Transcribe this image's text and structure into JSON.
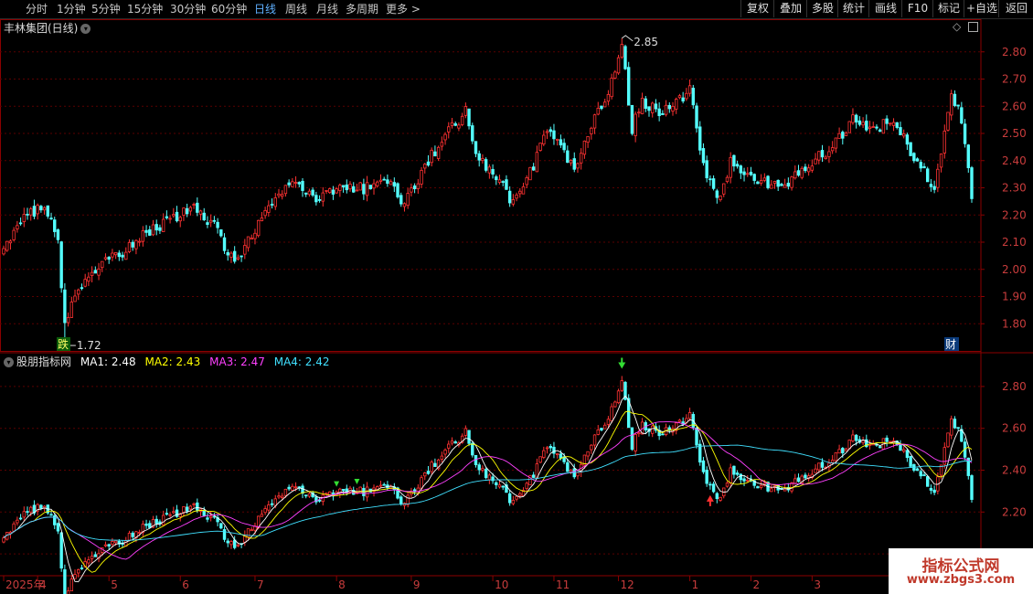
{
  "toolbar": {
    "periods": [
      {
        "label": "分时",
        "active": false
      },
      {
        "label": "1分钟",
        "active": false
      },
      {
        "label": "5分钟",
        "active": false
      },
      {
        "label": "15分钟",
        "active": false
      },
      {
        "label": "30分钟",
        "active": false
      },
      {
        "label": "60分钟",
        "active": false
      },
      {
        "label": "日线",
        "active": true
      },
      {
        "label": "周线",
        "active": false
      },
      {
        "label": "月线",
        "active": false
      },
      {
        "label": "多周期",
        "active": false
      },
      {
        "label": "更多 >",
        "active": false
      }
    ],
    "actions": [
      "复权",
      "叠加",
      "多股",
      "统计",
      "画线",
      "F10",
      "标记",
      "+自选",
      "返回"
    ]
  },
  "main_panel": {
    "title": "丰林集团(日线)",
    "high_marker": "2.85",
    "low_marker": "1.72",
    "badge_left": "跌",
    "badge_right": "财",
    "y_labels": [
      "2.80",
      "2.70",
      "2.60",
      "2.50",
      "2.40",
      "2.30",
      "2.20",
      "2.10",
      "2.00",
      "1.90",
      "1.80"
    ]
  },
  "indicator_panel": {
    "name": "股朋指标网",
    "ma": [
      {
        "label": "MA1:",
        "value": "2.48",
        "color": "#ffffff"
      },
      {
        "label": "MA2:",
        "value": "2.43",
        "color": "#ffff00"
      },
      {
        "label": "MA3:",
        "value": "2.47",
        "color": "#ff40ff"
      },
      {
        "label": "MA4:",
        "value": "2.42",
        "color": "#40e0ff"
      }
    ],
    "y_labels": [
      "2.80",
      "2.60",
      "2.40",
      "2.20",
      "2.00"
    ]
  },
  "date_axis": {
    "labels": [
      "2025年",
      "4",
      "5",
      "6",
      "7",
      "8",
      "9",
      "10",
      "11",
      "12",
      "1",
      "2",
      "3"
    ]
  },
  "watermark": {
    "line1": "指标公式网",
    "line2": "www.zbgs3.com"
  },
  "colors": {
    "up": "#ff3232",
    "down": "#54ffff",
    "grid": "#5a0000",
    "border": "#8b0000",
    "axis_text": "#c83c3c"
  },
  "chart_data": {
    "type": "candlestick",
    "title": "丰林集团(日线)",
    "price_range_main": [
      1.7,
      2.9
    ],
    "price_range_indicator": [
      1.9,
      2.9
    ],
    "month_start_index": [
      0,
      10,
      31,
      52,
      74,
      98,
      120,
      144,
      162,
      181,
      202,
      220,
      238
    ],
    "close_path": [
      [
        0,
        2.07
      ],
      [
        5,
        2.18
      ],
      [
        12,
        2.24
      ],
      [
        16,
        2.1
      ],
      [
        18,
        1.8
      ],
      [
        22,
        1.93
      ],
      [
        30,
        2.03
      ],
      [
        34,
        2.05
      ],
      [
        40,
        2.12
      ],
      [
        48,
        2.18
      ],
      [
        56,
        2.22
      ],
      [
        62,
        2.16
      ],
      [
        68,
        2.02
      ],
      [
        74,
        2.15
      ],
      [
        80,
        2.26
      ],
      [
        86,
        2.32
      ],
      [
        92,
        2.26
      ],
      [
        98,
        2.3
      ],
      [
        106,
        2.3
      ],
      [
        112,
        2.34
      ],
      [
        118,
        2.24
      ],
      [
        126,
        2.42
      ],
      [
        132,
        2.52
      ],
      [
        136,
        2.58
      ],
      [
        140,
        2.4
      ],
      [
        146,
        2.33
      ],
      [
        150,
        2.24
      ],
      [
        154,
        2.32
      ],
      [
        160,
        2.52
      ],
      [
        164,
        2.45
      ],
      [
        168,
        2.36
      ],
      [
        174,
        2.55
      ],
      [
        178,
        2.66
      ],
      [
        180,
        2.73
      ],
      [
        182,
        2.82
      ],
      [
        185,
        2.52
      ],
      [
        188,
        2.62
      ],
      [
        193,
        2.58
      ],
      [
        197,
        2.6
      ],
      [
        202,
        2.66
      ],
      [
        206,
        2.37
      ],
      [
        211,
        2.25
      ],
      [
        214,
        2.4
      ],
      [
        220,
        2.35
      ],
      [
        226,
        2.31
      ],
      [
        232,
        2.33
      ],
      [
        238,
        2.4
      ],
      [
        244,
        2.45
      ],
      [
        250,
        2.55
      ],
      [
        256,
        2.51
      ],
      [
        262,
        2.56
      ],
      [
        266,
        2.45
      ],
      [
        270,
        2.38
      ],
      [
        274,
        2.3
      ],
      [
        277,
        2.5
      ],
      [
        279,
        2.65
      ],
      [
        282,
        2.55
      ],
      [
        285,
        2.26
      ]
    ],
    "ma_last": {
      "MA1": 2.48,
      "MA2": 2.43,
      "MA3": 2.47,
      "MA4": 2.42
    }
  }
}
